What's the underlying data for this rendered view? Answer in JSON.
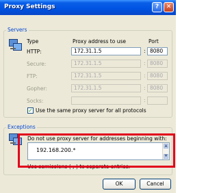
{
  "window": {
    "title": "Proxy Settings"
  },
  "servers": {
    "legend": "Servers",
    "col_type": "Type",
    "col_address": "Proxy address to use",
    "col_port": "Port",
    "rows": [
      {
        "type": "HTTP:",
        "address": "172.31.1.5",
        "port": "8080",
        "enabled": true
      },
      {
        "type": "Secure:",
        "address": "172.31.1.5",
        "port": "8080",
        "enabled": false
      },
      {
        "type": "FTP:",
        "address": "172.31.1.5",
        "port": "8080",
        "enabled": false
      },
      {
        "type": "Gopher:",
        "address": "172.31.1.5",
        "port": "8080",
        "enabled": false
      },
      {
        "type": "Socks:",
        "address": "",
        "port": "",
        "enabled": false
      }
    ],
    "same_proxy_label": "Use the same proxy server for all protocols",
    "same_proxy_checked": true
  },
  "exceptions": {
    "legend": "Exceptions",
    "intro": "Do not use proxy server for addresses beginning with:",
    "value": "192.168.200.*",
    "hint": "Use semicolons ( ; ) to separate entries."
  },
  "buttons": {
    "ok": "OK",
    "cancel": "Cancel"
  },
  "colors": {
    "highlight": "#e0001b",
    "title_bar": "#0054e3"
  }
}
